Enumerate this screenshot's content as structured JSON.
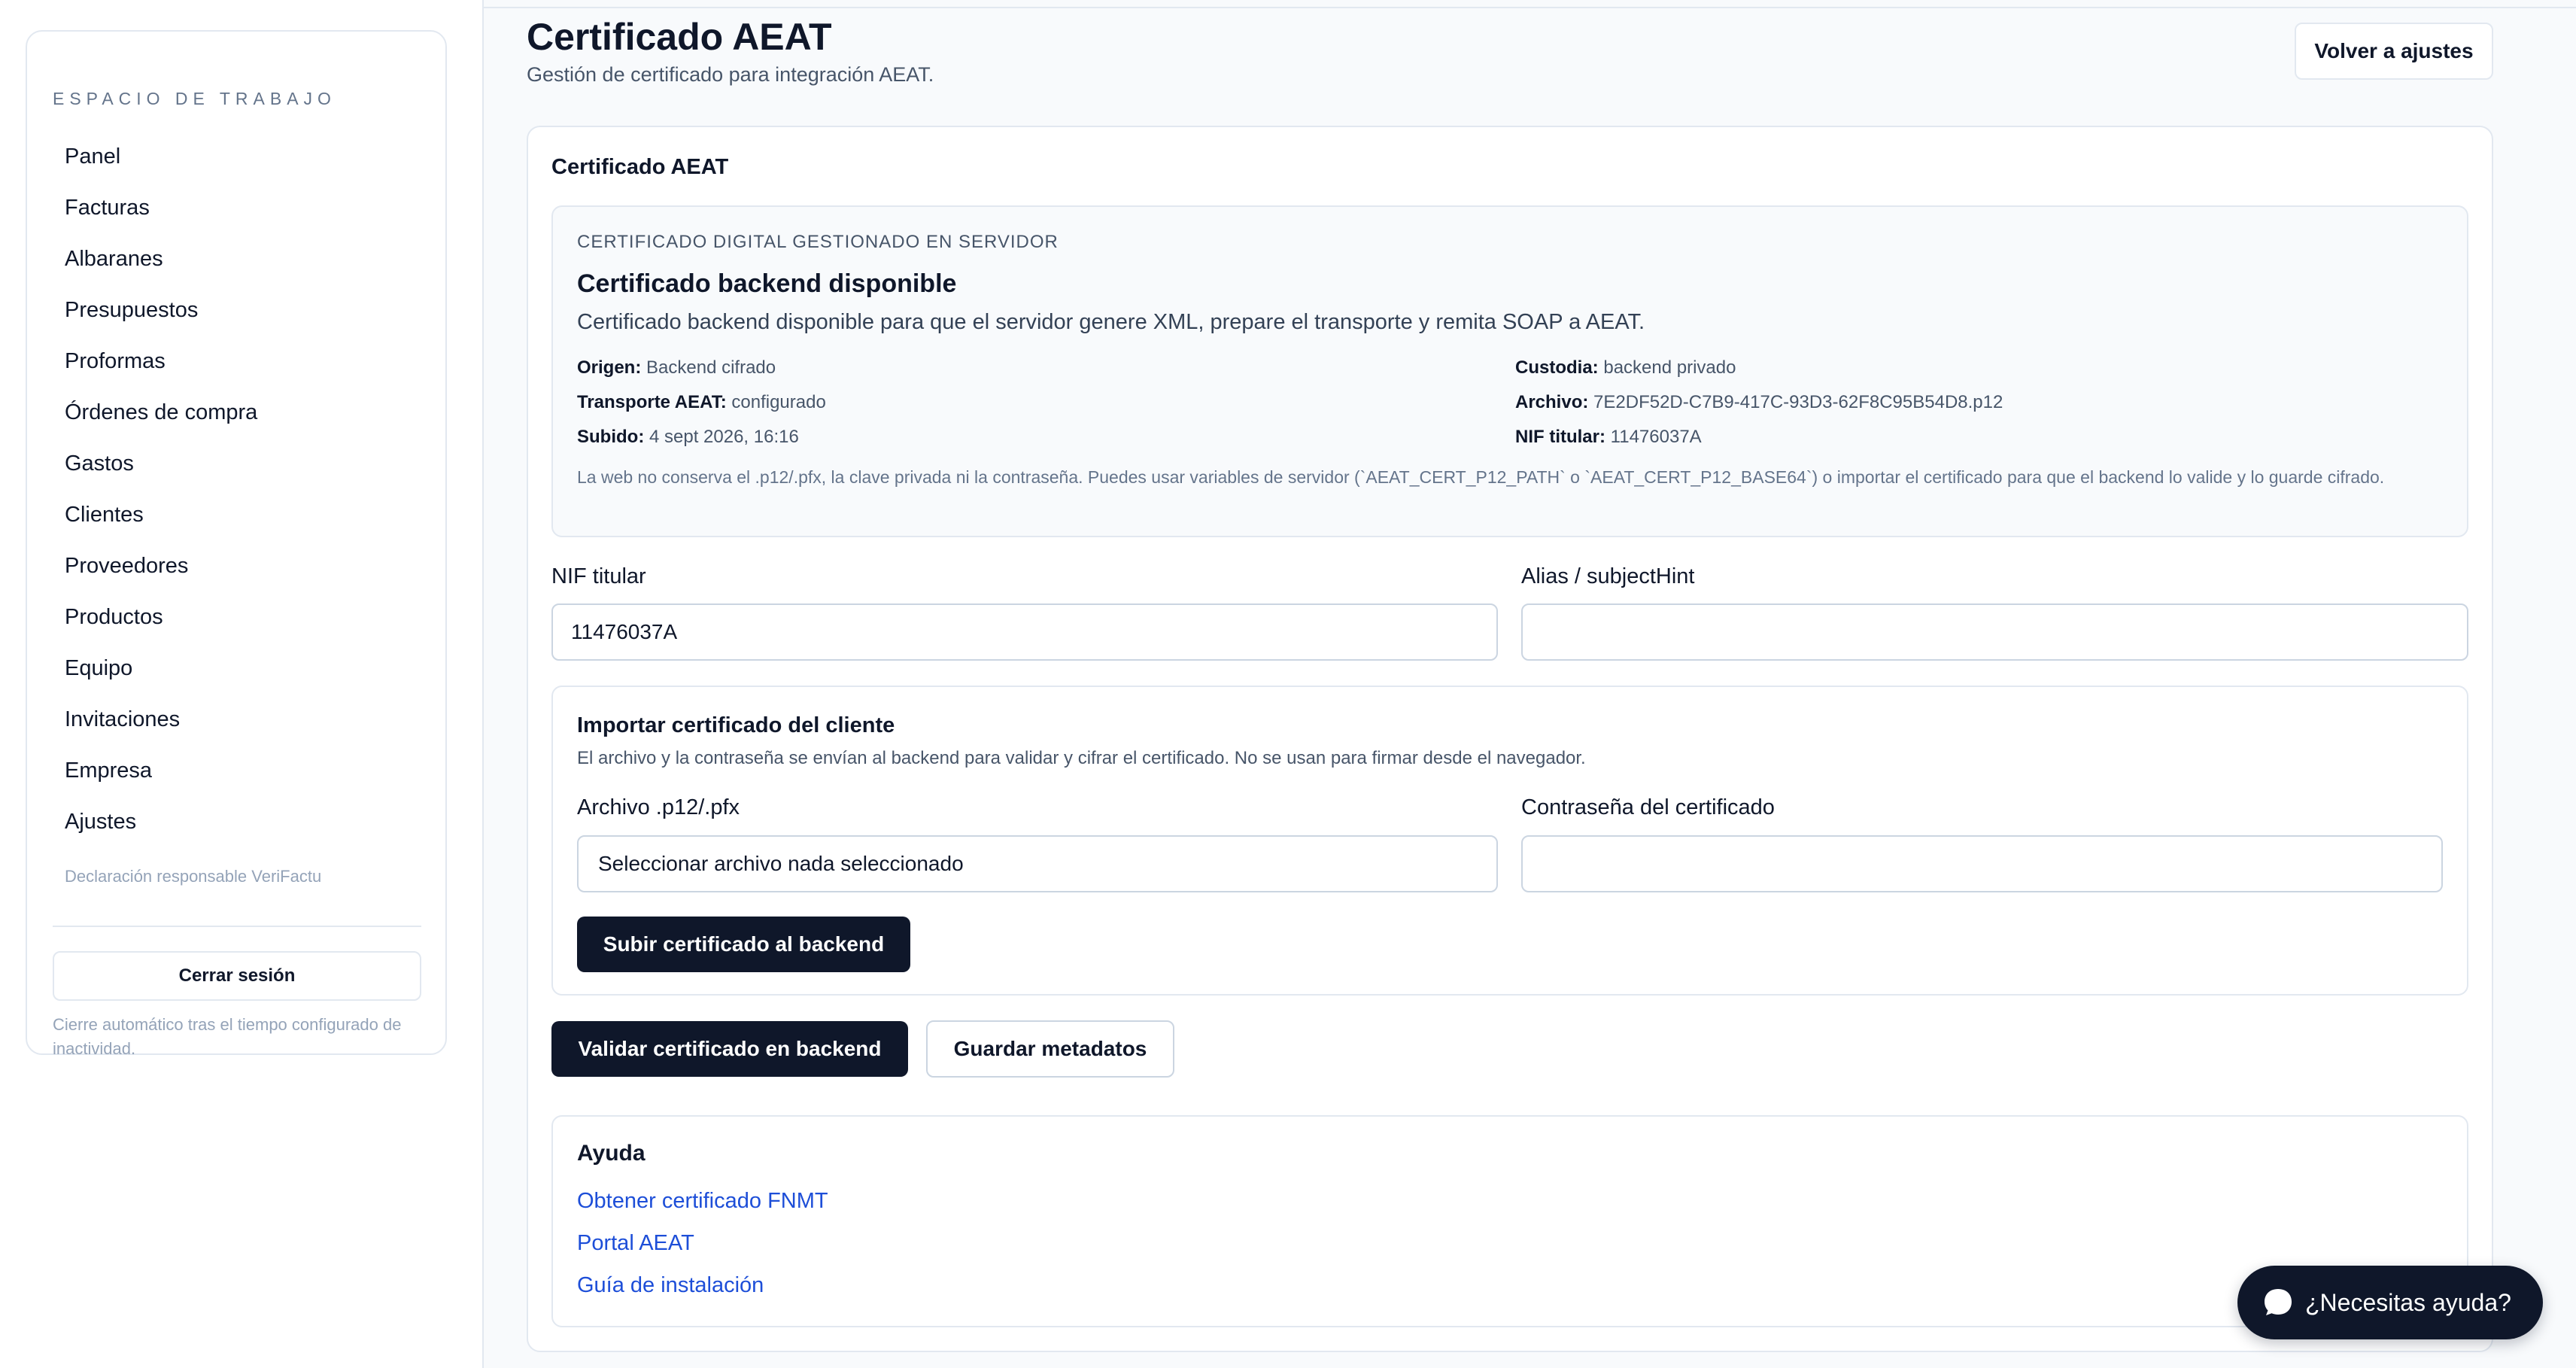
{
  "sidebar": {
    "workspace_title": "ESPACIO DE TRABAJO",
    "items": [
      {
        "label": "Panel"
      },
      {
        "label": "Facturas"
      },
      {
        "label": "Albaranes"
      },
      {
        "label": "Presupuestos"
      },
      {
        "label": "Proformas"
      },
      {
        "label": "Órdenes de compra"
      },
      {
        "label": "Gastos"
      },
      {
        "label": "Clientes"
      },
      {
        "label": "Proveedores"
      },
      {
        "label": "Productos"
      },
      {
        "label": "Equipo"
      },
      {
        "label": "Invitaciones"
      },
      {
        "label": "Empresa"
      },
      {
        "label": "Ajustes"
      }
    ],
    "note": "Declaración responsable VeriFactu",
    "logout_label": "Cerrar sesión",
    "footnote": "Cierre automático tras el tiempo configurado de inactividad."
  },
  "header": {
    "title": "Certificado AEAT",
    "subtitle": "Gestión de certificado para integración AEAT.",
    "back_label": "Volver a ajustes"
  },
  "card": {
    "heading": "Certificado AEAT",
    "info": {
      "kicker": "CERTIFICADO DIGITAL GESTIONADO EN SERVIDOR",
      "title": "Certificado backend disponible",
      "description": "Certificado backend disponible para que el servidor genere XML, prepare el transporte y remita SOAP a AEAT.",
      "origen_label": "Origen:",
      "origen_value": "Backend cifrado",
      "transporte_label": "Transporte AEAT:",
      "transporte_value": "configurado",
      "subido_label": "Subido:",
      "subido_value": "4 sept 2026, 16:16",
      "custodia_label": "Custodia:",
      "custodia_value": "backend privado",
      "archivo_label": "Archivo:",
      "archivo_value": "7E2DF52D-C7B9-417C-93D3-62F8C95B54D8.p12",
      "nif_label": "NIF titular:",
      "nif_value": "11476037A",
      "note": "La web no conserva el .p12/.pfx, la clave privada ni la contraseña. Puedes usar variables de servidor (`AEAT_CERT_P12_PATH` o `AEAT_CERT_P12_BASE64`) o importar el certificado para que el backend lo valide y lo guarde cifrado."
    },
    "fields": {
      "nif_label": "NIF titular",
      "nif_value": "11476037A",
      "alias_label": "Alias / subjectHint",
      "alias_value": ""
    },
    "import": {
      "title": "Importar certificado del cliente",
      "description": "El archivo y la contraseña se envían al backend para validar y cifrar el certificado. No se usan para firmar desde el navegador.",
      "file_label": "Archivo .p12/.pfx",
      "file_value": "Seleccionar archivo nada seleccionado",
      "password_label": "Contraseña del certificado",
      "password_value": "",
      "upload_label": "Subir certificado al backend"
    },
    "actions": {
      "validate_label": "Validar certificado en backend",
      "save_label": "Guardar metadatos"
    },
    "help": {
      "title": "Ayuda",
      "links": [
        {
          "label": "Obtener certificado FNMT"
        },
        {
          "label": "Portal AEAT"
        },
        {
          "label": "Guía de instalación"
        }
      ]
    }
  },
  "chat": {
    "label": "¿Necesitas ayuda?",
    "icon": "chat-bubble-icon"
  },
  "colors": {
    "primary": "#0f172a",
    "link": "#1d4ed8",
    "border": "#e2e8f0",
    "background": "#f8fafc"
  }
}
